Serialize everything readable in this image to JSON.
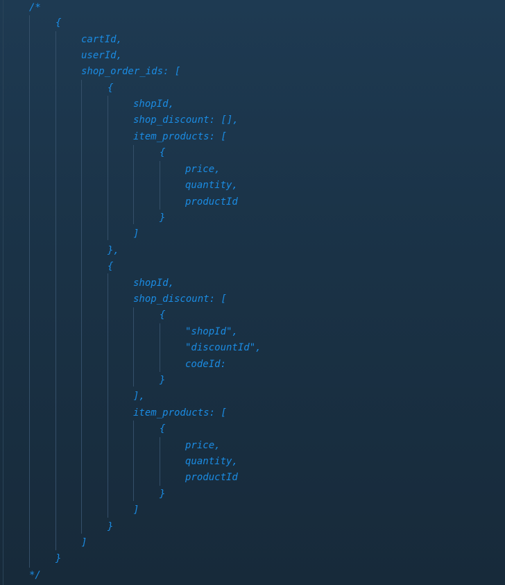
{
  "editor": {
    "theme_colors": {
      "comment_text": "#1b8ce3",
      "background_top": "#1e3a52",
      "background_bottom": "#172a3a",
      "indent_guide": "#35506a"
    },
    "lines": [
      "/*",
      "{",
      "cartId,",
      "userId,",
      "shop_order_ids: [",
      "{",
      "shopId,",
      "shop_discount: [],",
      "item_products: [",
      "{",
      "price,",
      "quantity,",
      "productId",
      "}",
      "]",
      "},",
      "{",
      "shopId,",
      "shop_discount: [",
      "{",
      "\"shopId\",",
      "\"discountId\",",
      "codeId:",
      "}",
      "],",
      "item_products: [",
      "{",
      "price,",
      "quantity,",
      "productId",
      "}",
      "]",
      "}",
      "]",
      "}",
      "*/"
    ]
  }
}
